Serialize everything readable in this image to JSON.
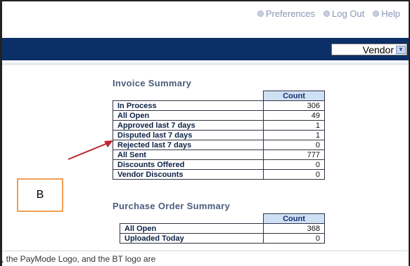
{
  "header": {
    "links": [
      {
        "name": "preferences",
        "label": "Preferences"
      },
      {
        "name": "logout",
        "label": "Log Out"
      },
      {
        "name": "help",
        "label": "Help"
      }
    ]
  },
  "nav": {
    "vendor_select_value": "Vendor"
  },
  "invoice_summary": {
    "title": "Invoice Summary",
    "count_header": "Count",
    "rows": [
      {
        "label": "In Process",
        "count": "306"
      },
      {
        "label": "All Open",
        "count": "49"
      },
      {
        "label": "Approved last 7 days",
        "count": "1"
      },
      {
        "label": "Disputed last 7 days",
        "count": "1"
      },
      {
        "label": "Rejected last 7 days",
        "count": "0"
      },
      {
        "label": "All Sent",
        "count": "777"
      },
      {
        "label": "Discounts Offered",
        "count": "0"
      },
      {
        "label": "Vendor Discounts",
        "count": "0"
      }
    ]
  },
  "po_summary": {
    "title": "Purchase Order Summary",
    "count_header": "Count",
    "rows": [
      {
        "label": "All Open",
        "count": "368"
      },
      {
        "label": "Uploaded Today",
        "count": "0"
      }
    ]
  },
  "annotation": {
    "box_label": "B",
    "arrow_color": "#c0262c",
    "box_color": "#f09e56"
  },
  "footer": {
    "text": "s, the PayMode Logo, and the BT logo are"
  },
  "colors": {
    "nav_bar": "#0d2f67",
    "count_header_bg": "#cfe0f4",
    "link_color": "#8a96b4"
  }
}
